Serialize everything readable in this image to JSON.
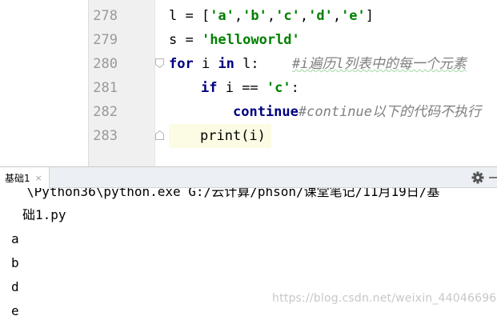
{
  "editor": {
    "lines": [
      {
        "num": "278",
        "tokens": [
          "l = [",
          "'a'",
          ",",
          "'b'",
          ",",
          "'c'",
          ",",
          "'d'",
          ",",
          "'e'",
          "]"
        ]
      },
      {
        "num": "279",
        "tokens": [
          "s = ",
          "'helloworld'"
        ]
      },
      {
        "num": "280",
        "kw1": "for",
        "mid1": " i ",
        "kw2": "in",
        "mid2": " l:",
        "comment": "#i遍历l列表中的每一个元素"
      },
      {
        "num": "281",
        "kw": "if",
        "mid": " i == ",
        "str": "'c'",
        "end": ":"
      },
      {
        "num": "282",
        "kw": "continue",
        "comment": "#continue以下的代码不执行"
      },
      {
        "num": "283",
        "code": "print(i)"
      }
    ]
  },
  "tool_window": {
    "tab_label": "基础1",
    "close_glyph": "×"
  },
  "console": {
    "path_line1": "\\Python36\\python.exe G:/云计算/phson/课堂笔记/11月19日/基",
    "path_line2": "础1.py",
    "outputs": [
      "a",
      "b",
      "d",
      "e"
    ]
  },
  "watermark": "https://blog.csdn.net/weixin_44046696",
  "colors": {
    "keyword": "#000080",
    "string": "#008000",
    "comment": "#808080",
    "line_number": "#999999",
    "gutter_bg": "#f0f0f0",
    "caret_line": "#fcfbe3"
  },
  "icons": {
    "settings": "gear-icon",
    "fold_marker": "fold-marker-icon"
  }
}
